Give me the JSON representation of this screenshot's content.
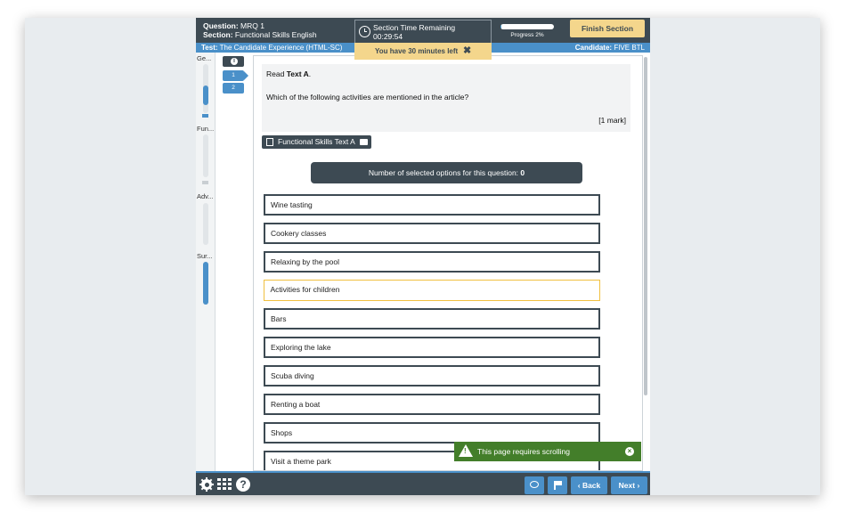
{
  "header": {
    "question_label": "Question:",
    "question_value": "MRQ 1",
    "section_label": "Section:",
    "section_value": "Functional Skills English",
    "timer_title": "Section Time Remaining",
    "timer_value": "00:29:54",
    "progress_label": "Progress 2%",
    "progress_fraction": 0.02,
    "finish_button": "Finish Section"
  },
  "infobar": {
    "test_label": "Test:",
    "test_value": "The Candidate Experience (HTML-SC)",
    "candidate_label": "Candidate:",
    "candidate_value": "FIVE BTL"
  },
  "time_warning": {
    "text": "You have 30 minutes left",
    "close_glyph": "✖"
  },
  "sidebar": {
    "sections": [
      "Ge...",
      "Fun...",
      "Adv...",
      "Sur..."
    ]
  },
  "qnav": {
    "buttons": [
      "1",
      "2"
    ]
  },
  "question": {
    "read_prefix": "Read ",
    "read_bold": "Text A",
    "read_suffix": ".",
    "prompt": "Which of the following activities are mentioned in the article?",
    "mark": "[1 mark]"
  },
  "text_button": "Functional Skills Text A",
  "counter": {
    "label": "Number of selected options for this question: ",
    "count": "0"
  },
  "options": [
    "Wine tasting",
    "Cookery classes",
    "Relaxing by the pool",
    "Activities for children",
    "Bars",
    "Exploring the lake",
    "Scuba diving",
    "Renting a boat",
    "Shops",
    "Visit a theme park"
  ],
  "scroll_toast": {
    "text": "This page requires scrolling",
    "close_glyph": "×"
  },
  "footer": {
    "back_label": "Back",
    "next_label": "Next",
    "back_glyph": "‹",
    "next_glyph": "›",
    "help_glyph": "?"
  },
  "colors": {
    "dark": "#3d4a53",
    "accent_blue": "#4a90c9",
    "warning_yellow": "#f4d68c",
    "toast_green": "#437e2a",
    "focus_outline": "#f0c040"
  }
}
